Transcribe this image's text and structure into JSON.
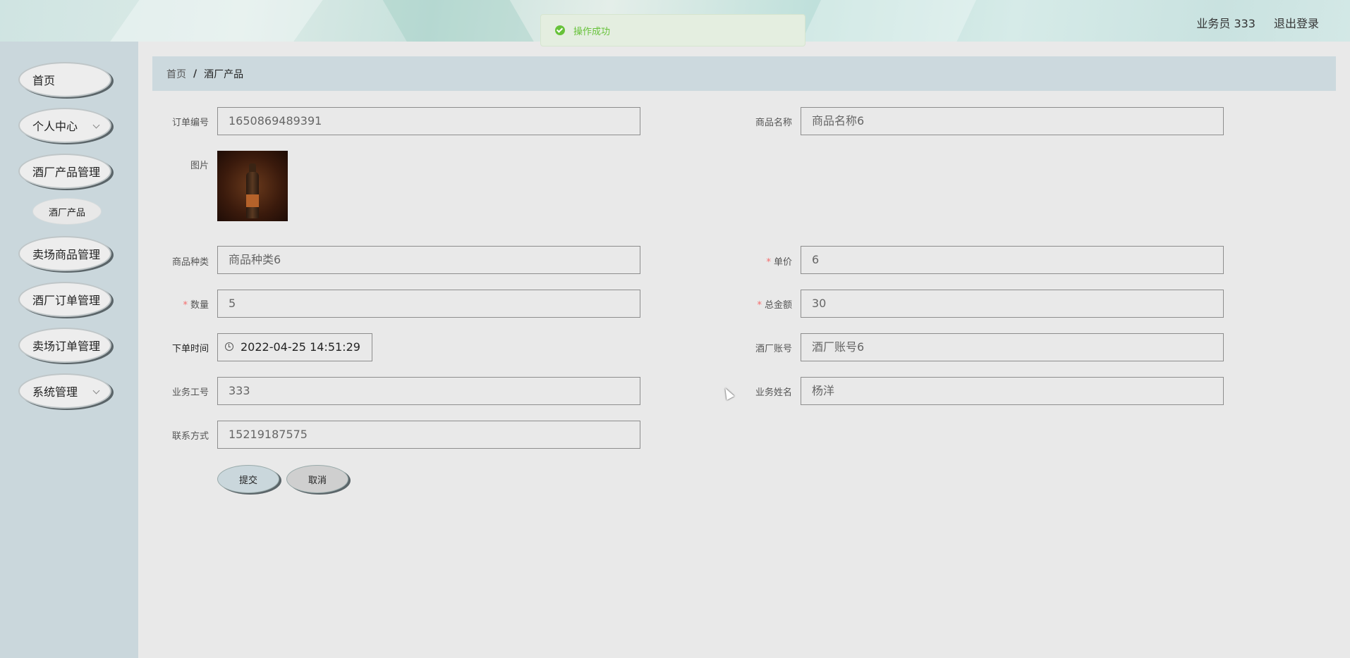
{
  "header": {
    "user_label": "业务员 333",
    "logout_label": "退出登录"
  },
  "toast": {
    "text": "操作成功",
    "icon": "check-circle-icon",
    "color": "#67c23a"
  },
  "sidebar": {
    "items": [
      {
        "label": "首页"
      },
      {
        "label": "个人中心",
        "expandable": true
      },
      {
        "label": "酒厂产品管理"
      },
      {
        "label": "卖场商品管理"
      },
      {
        "label": "酒厂订单管理"
      },
      {
        "label": "卖场订单管理"
      },
      {
        "label": "系统管理",
        "expandable": true
      }
    ],
    "sub_item": {
      "label": "酒厂产品"
    }
  },
  "breadcrumb": {
    "home": "首页",
    "separator": "/",
    "current": "酒厂产品"
  },
  "form": {
    "order_no": {
      "label": "订单编号",
      "value": "1650869489391"
    },
    "product_name": {
      "label": "商品名称",
      "value": "商品名称6"
    },
    "image": {
      "label": "图片"
    },
    "category": {
      "label": "商品种类",
      "value": "商品种类6"
    },
    "unit_price": {
      "label": "单价",
      "value": "6",
      "required": true
    },
    "quantity": {
      "label": "数量",
      "value": "5",
      "required": true
    },
    "total": {
      "label": "总金额",
      "value": "30",
      "required": true
    },
    "order_time": {
      "label": "下单时间",
      "value": "2022-04-25 14:51:29"
    },
    "winery_account": {
      "label": "酒厂账号",
      "value": "酒厂账号6"
    },
    "staff_no": {
      "label": "业务工号",
      "value": "333"
    },
    "staff_name": {
      "label": "业务姓名",
      "value": "杨洋"
    },
    "contact": {
      "label": "联系方式",
      "value": "15219187575"
    },
    "required_mark": "*"
  },
  "buttons": {
    "submit": "提交",
    "cancel": "取消"
  },
  "colors": {
    "sidebar_bg": "#cad7dc",
    "breadcrumb_bg": "#ccd9de",
    "page_bg": "#e9e9e9"
  }
}
